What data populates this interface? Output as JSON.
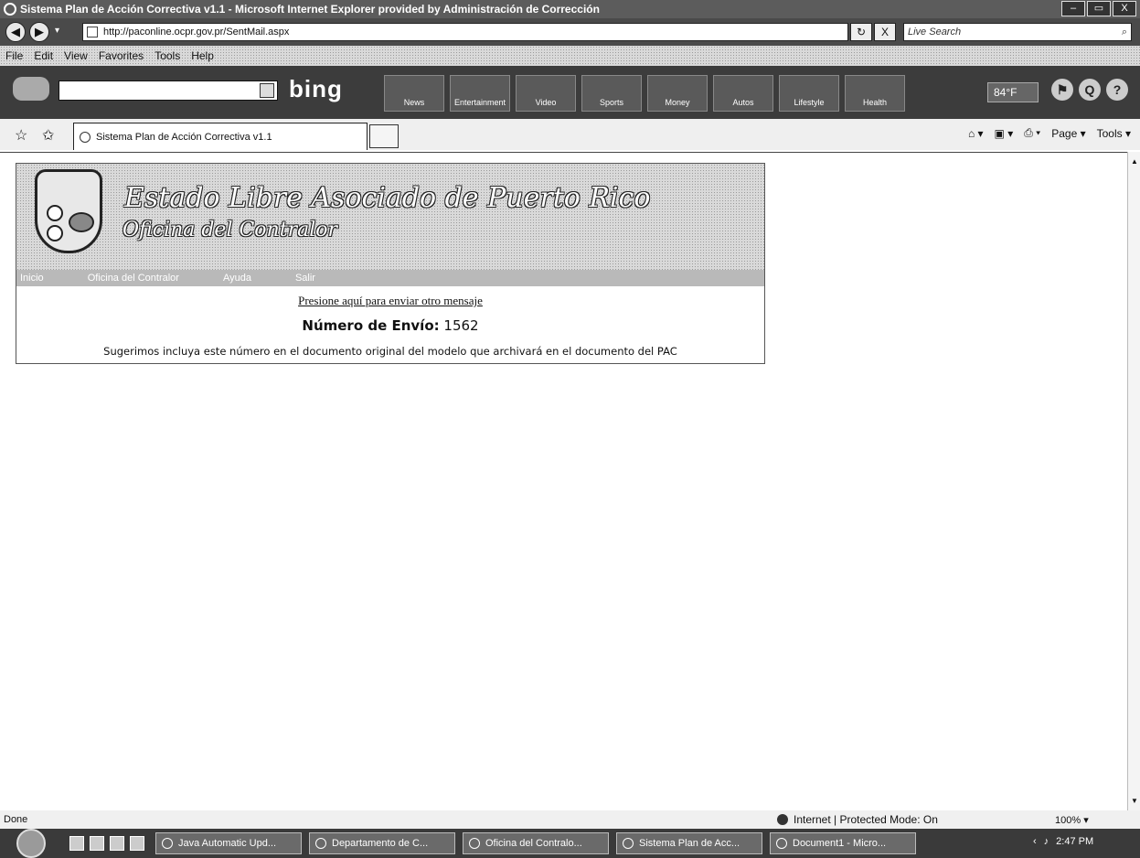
{
  "window": {
    "title": "Sistema Plan de Acción Correctiva v1.1 - Microsoft Internet Explorer provided by Administración de Corrección",
    "controls": [
      "–",
      "▭",
      "X"
    ]
  },
  "address_bar": {
    "url": "http://paconline.ocpr.gov.pr/SentMail.aspx",
    "search_placeholder": "Live Search",
    "refresh": "↻",
    "stop": "X",
    "search_btn": "⌕"
  },
  "menu": [
    "File",
    "Edit",
    "View",
    "Favorites",
    "Tools",
    "Help"
  ],
  "bing_toolbar": {
    "logo": "bing",
    "tabs": [
      "News",
      "Entertainment",
      "Video",
      "Sports",
      "Money",
      "Autos",
      "Lifestyle",
      "Health"
    ],
    "weather": "84°F",
    "right_icons": [
      "⚑",
      "Q",
      "?"
    ]
  },
  "tabs": {
    "active": "Sistema Plan de Acción Correctiva v1.1"
  },
  "command_bar": {
    "home": "⌂ ▾",
    "feeds": "▣ ▾",
    "print": "⎙ ▾",
    "page": "Page ▾",
    "tools": "Tools ▾"
  },
  "page": {
    "heading1": "Estado Libre Asociado de Puerto Rico",
    "heading2": "Oficina del Contralor",
    "nav": [
      "Inicio",
      "Oficina del Contralor",
      "Ayuda",
      "Salir"
    ],
    "link": "Presione aquí para enviar otro mensaje",
    "numero_label": "Número de Envío:",
    "numero_value": "1562",
    "suggestion": "Sugerimos incluya este número en el documento original del modelo que archivará en el documento del PAC"
  },
  "status_bar": {
    "status": "Done",
    "zone": "Internet | Protected Mode: On",
    "zoom": "100%"
  },
  "taskbar": {
    "items": [
      "Java Automatic Upd...",
      "Departamento de C...",
      "Oficina del Contralo...",
      "Sistema Plan de Acc...",
      "Document1 - Micro..."
    ],
    "clock": "2:47 PM"
  }
}
